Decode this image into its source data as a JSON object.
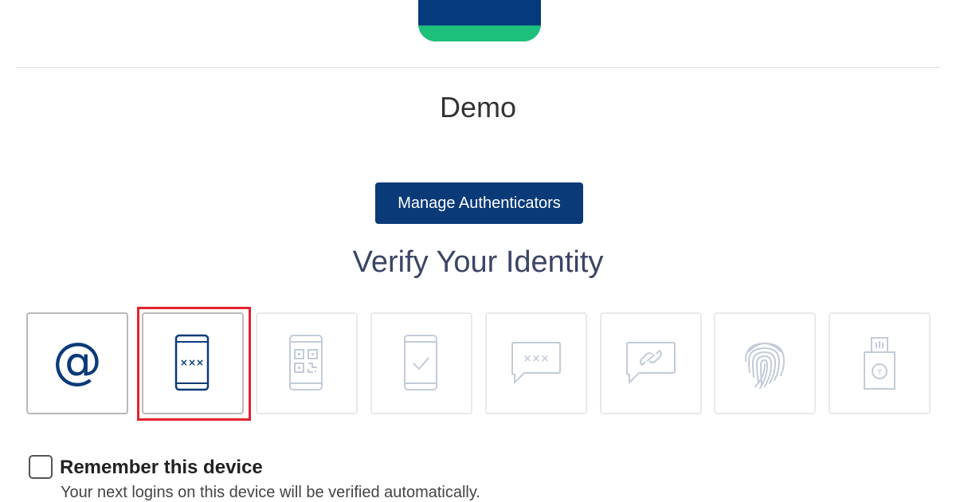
{
  "brand": {
    "logo_icon": "brand-logo-icon",
    "primary_color": "#0a3a78",
    "accent_color": "#1cc07a"
  },
  "tenant": {
    "name": "Demo"
  },
  "actions": {
    "manage_authenticators": "Manage Authenticators"
  },
  "verify": {
    "heading": "Verify Your Identity",
    "methods": [
      {
        "id": "email",
        "icon": "at-sign-icon",
        "state": "enabled"
      },
      {
        "id": "sms-code",
        "icon": "phone-code-icon",
        "state": "selected"
      },
      {
        "id": "qr-code",
        "icon": "qr-code-phone-icon",
        "state": "disabled"
      },
      {
        "id": "push",
        "icon": "phone-check-icon",
        "state": "disabled"
      },
      {
        "id": "message-otp",
        "icon": "chat-code-icon",
        "state": "disabled"
      },
      {
        "id": "link",
        "icon": "chat-link-icon",
        "state": "disabled"
      },
      {
        "id": "biometric",
        "icon": "fingerprint-icon",
        "state": "disabled"
      },
      {
        "id": "security-key",
        "icon": "usb-key-icon",
        "state": "disabled"
      }
    ]
  },
  "remember": {
    "checked": false,
    "label": "Remember this device",
    "description": "Your next logins on this device will be verified automatically."
  },
  "colors": {
    "heading": "#3b4564",
    "icon_active": "#0a3a78",
    "icon_disabled": "#c3cbd8",
    "highlight": "#e3222f"
  }
}
